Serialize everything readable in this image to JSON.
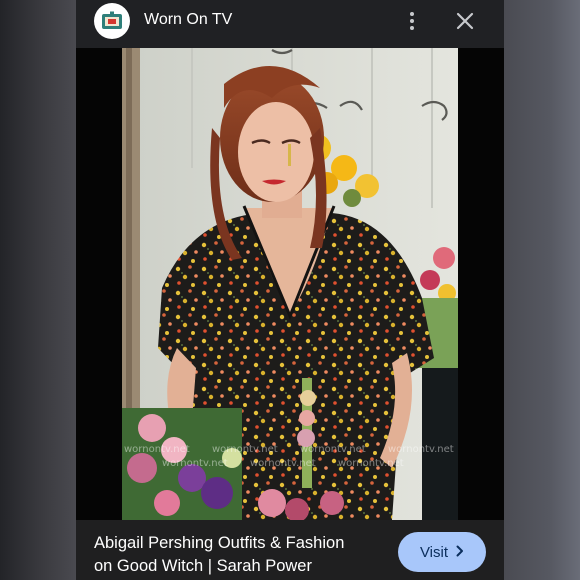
{
  "header": {
    "app_title": "Worn On TV",
    "app_icon": "tv-icon",
    "menu_icon": "more-vert-icon",
    "close_icon": "close-icon"
  },
  "image": {
    "watermark": "wornontv.net"
  },
  "footer": {
    "title_line1": "Abigail Pershing Outfits & Fashion",
    "title_line2": "on Good Witch | Sarah Power",
    "visit_label": "Visit",
    "visit_icon": "chevron-right-icon"
  },
  "colors": {
    "card_bg": "#202124",
    "button_bg": "#a8c7fa",
    "button_text": "#0b2e5c"
  }
}
